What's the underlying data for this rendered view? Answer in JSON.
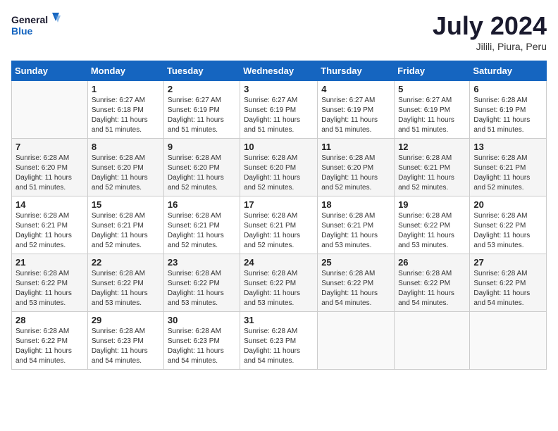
{
  "logo": {
    "line1": "General",
    "line2": "Blue"
  },
  "title": "July 2024",
  "location": "Jilili, Piura, Peru",
  "weekdays": [
    "Sunday",
    "Monday",
    "Tuesday",
    "Wednesday",
    "Thursday",
    "Friday",
    "Saturday"
  ],
  "weeks": [
    [
      {
        "day": "",
        "sunrise": "",
        "sunset": "",
        "daylight": "",
        "empty": true
      },
      {
        "day": "1",
        "sunrise": "6:27 AM",
        "sunset": "6:18 PM",
        "daylight": "11 hours and 51 minutes."
      },
      {
        "day": "2",
        "sunrise": "6:27 AM",
        "sunset": "6:19 PM",
        "daylight": "11 hours and 51 minutes."
      },
      {
        "day": "3",
        "sunrise": "6:27 AM",
        "sunset": "6:19 PM",
        "daylight": "11 hours and 51 minutes."
      },
      {
        "day": "4",
        "sunrise": "6:27 AM",
        "sunset": "6:19 PM",
        "daylight": "11 hours and 51 minutes."
      },
      {
        "day": "5",
        "sunrise": "6:27 AM",
        "sunset": "6:19 PM",
        "daylight": "11 hours and 51 minutes."
      },
      {
        "day": "6",
        "sunrise": "6:28 AM",
        "sunset": "6:19 PM",
        "daylight": "11 hours and 51 minutes."
      }
    ],
    [
      {
        "day": "7",
        "sunrise": "6:28 AM",
        "sunset": "6:20 PM",
        "daylight": "11 hours and 51 minutes."
      },
      {
        "day": "8",
        "sunrise": "6:28 AM",
        "sunset": "6:20 PM",
        "daylight": "11 hours and 52 minutes."
      },
      {
        "day": "9",
        "sunrise": "6:28 AM",
        "sunset": "6:20 PM",
        "daylight": "11 hours and 52 minutes."
      },
      {
        "day": "10",
        "sunrise": "6:28 AM",
        "sunset": "6:20 PM",
        "daylight": "11 hours and 52 minutes."
      },
      {
        "day": "11",
        "sunrise": "6:28 AM",
        "sunset": "6:20 PM",
        "daylight": "11 hours and 52 minutes."
      },
      {
        "day": "12",
        "sunrise": "6:28 AM",
        "sunset": "6:21 PM",
        "daylight": "11 hours and 52 minutes."
      },
      {
        "day": "13",
        "sunrise": "6:28 AM",
        "sunset": "6:21 PM",
        "daylight": "11 hours and 52 minutes."
      }
    ],
    [
      {
        "day": "14",
        "sunrise": "6:28 AM",
        "sunset": "6:21 PM",
        "daylight": "11 hours and 52 minutes."
      },
      {
        "day": "15",
        "sunrise": "6:28 AM",
        "sunset": "6:21 PM",
        "daylight": "11 hours and 52 minutes."
      },
      {
        "day": "16",
        "sunrise": "6:28 AM",
        "sunset": "6:21 PM",
        "daylight": "11 hours and 52 minutes."
      },
      {
        "day": "17",
        "sunrise": "6:28 AM",
        "sunset": "6:21 PM",
        "daylight": "11 hours and 52 minutes."
      },
      {
        "day": "18",
        "sunrise": "6:28 AM",
        "sunset": "6:21 PM",
        "daylight": "11 hours and 53 minutes."
      },
      {
        "day": "19",
        "sunrise": "6:28 AM",
        "sunset": "6:22 PM",
        "daylight": "11 hours and 53 minutes."
      },
      {
        "day": "20",
        "sunrise": "6:28 AM",
        "sunset": "6:22 PM",
        "daylight": "11 hours and 53 minutes."
      }
    ],
    [
      {
        "day": "21",
        "sunrise": "6:28 AM",
        "sunset": "6:22 PM",
        "daylight": "11 hours and 53 minutes."
      },
      {
        "day": "22",
        "sunrise": "6:28 AM",
        "sunset": "6:22 PM",
        "daylight": "11 hours and 53 minutes."
      },
      {
        "day": "23",
        "sunrise": "6:28 AM",
        "sunset": "6:22 PM",
        "daylight": "11 hours and 53 minutes."
      },
      {
        "day": "24",
        "sunrise": "6:28 AM",
        "sunset": "6:22 PM",
        "daylight": "11 hours and 53 minutes."
      },
      {
        "day": "25",
        "sunrise": "6:28 AM",
        "sunset": "6:22 PM",
        "daylight": "11 hours and 54 minutes."
      },
      {
        "day": "26",
        "sunrise": "6:28 AM",
        "sunset": "6:22 PM",
        "daylight": "11 hours and 54 minutes."
      },
      {
        "day": "27",
        "sunrise": "6:28 AM",
        "sunset": "6:22 PM",
        "daylight": "11 hours and 54 minutes."
      }
    ],
    [
      {
        "day": "28",
        "sunrise": "6:28 AM",
        "sunset": "6:22 PM",
        "daylight": "11 hours and 54 minutes."
      },
      {
        "day": "29",
        "sunrise": "6:28 AM",
        "sunset": "6:23 PM",
        "daylight": "11 hours and 54 minutes."
      },
      {
        "day": "30",
        "sunrise": "6:28 AM",
        "sunset": "6:23 PM",
        "daylight": "11 hours and 54 minutes."
      },
      {
        "day": "31",
        "sunrise": "6:28 AM",
        "sunset": "6:23 PM",
        "daylight": "11 hours and 54 minutes."
      },
      {
        "day": "",
        "sunrise": "",
        "sunset": "",
        "daylight": "",
        "empty": true
      },
      {
        "day": "",
        "sunrise": "",
        "sunset": "",
        "daylight": "",
        "empty": true
      },
      {
        "day": "",
        "sunrise": "",
        "sunset": "",
        "daylight": "",
        "empty": true
      }
    ]
  ]
}
